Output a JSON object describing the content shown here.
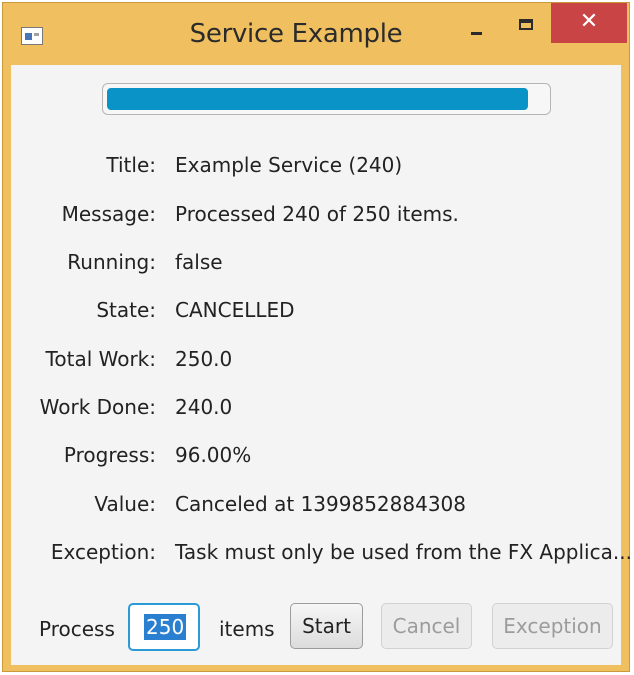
{
  "window": {
    "title": "Service Example",
    "close_glyph": "✕",
    "icons": [
      "app-icon",
      "minimize-icon",
      "maximize-icon",
      "close-icon"
    ]
  },
  "progress": {
    "fraction": 0.96,
    "color": "#0a93c6"
  },
  "fields": [
    {
      "label": "Title:",
      "value": "Example Service (240)"
    },
    {
      "label": "Message:",
      "value": "Processed 240 of 250 items."
    },
    {
      "label": "Running:",
      "value": "false"
    },
    {
      "label": "State:",
      "value": "CANCELLED"
    },
    {
      "label": "Total Work:",
      "value": "250.0"
    },
    {
      "label": "Work Done:",
      "value": "240.0"
    },
    {
      "label": "Progress:",
      "value": "96.00%"
    },
    {
      "label": "Value:",
      "value": "Canceled at 1399852884308"
    },
    {
      "label": "Exception:",
      "value": "Task must only be used from the FX Applica..."
    }
  ],
  "controls": {
    "process_label": "Process",
    "items_value": "250",
    "items_label": "items",
    "start_label": "Start",
    "cancel_label": "Cancel",
    "exception_label": "Exception"
  }
}
